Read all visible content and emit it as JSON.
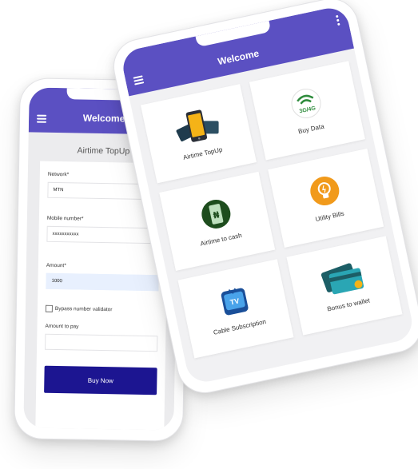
{
  "colors": {
    "primary": "#5b50c2",
    "button": "#1c1591",
    "screen_bg": "#f1f1f3"
  },
  "left_phone": {
    "appbar": {
      "title": "Welcome",
      "menu_icon": "hamburger-icon"
    },
    "form_title": "Airtime TopUp",
    "network": {
      "label": "Network*",
      "value": "MTN"
    },
    "mobile": {
      "label": "Mobile number*",
      "value": "xxxxxxxxxxx"
    },
    "amount": {
      "label": "Amount*",
      "value": "1000"
    },
    "bypass_label": "Bypass number validator",
    "amount_to_pay": {
      "label": "Amount to pay",
      "value": ""
    },
    "buy_button": "Buy Now"
  },
  "right_phone": {
    "appbar": {
      "title": "Welcome",
      "menu_icon": "hamburger-icon",
      "more_icon": "kebab-icon"
    },
    "tiles": [
      {
        "label": "Airtime TopUp",
        "icon": "airtime-phone-icon"
      },
      {
        "label": "Buy Data",
        "icon": "3g-4g-wifi-icon",
        "icon_text": "3G/4G"
      },
      {
        "label": "Airtime to cash",
        "icon": "naira-phone-icon"
      },
      {
        "label": "Utility Bills",
        "icon": "lightbulb-icon"
      },
      {
        "label": "Cable Subscription",
        "icon": "tv-icon"
      },
      {
        "label": "Bonus to wallet",
        "icon": "credit-cards-icon"
      }
    ]
  }
}
